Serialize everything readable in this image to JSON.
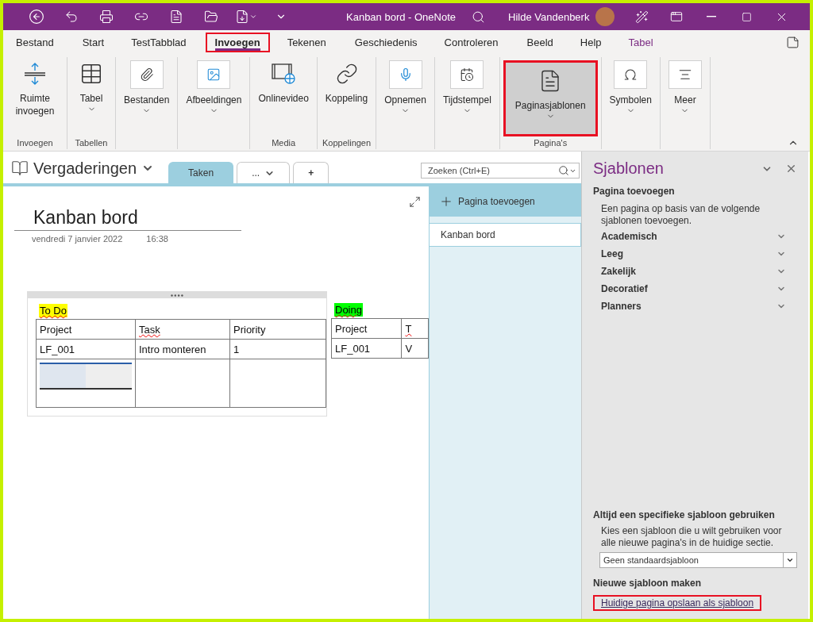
{
  "window": {
    "title": "Kanban bord - OneNote",
    "user": "Hilde Vandenberk"
  },
  "menu_tabs": [
    {
      "label": "Bestand",
      "selected": false,
      "highlighted": false,
      "kind": "normal"
    },
    {
      "label": "Start",
      "selected": false,
      "highlighted": false,
      "kind": "normal"
    },
    {
      "label": "TestTabblad",
      "selected": false,
      "highlighted": false,
      "kind": "normal"
    },
    {
      "label": "Invoegen",
      "selected": true,
      "highlighted": true,
      "kind": "normal"
    },
    {
      "label": "Tekenen",
      "selected": false,
      "highlighted": false,
      "kind": "normal"
    },
    {
      "label": "Geschiedenis",
      "selected": false,
      "highlighted": false,
      "kind": "normal"
    },
    {
      "label": "Controleren",
      "selected": false,
      "highlighted": false,
      "kind": "normal"
    },
    {
      "label": "Beeld",
      "selected": false,
      "highlighted": false,
      "kind": "normal"
    },
    {
      "label": "Help",
      "selected": false,
      "highlighted": false,
      "kind": "normal"
    },
    {
      "label": "Tabel",
      "selected": false,
      "highlighted": false,
      "kind": "contextual"
    }
  ],
  "ribbon_groups": [
    {
      "label": "Invoegen",
      "buttons": [
        {
          "label": "Ruimte invoegen",
          "kind": "plain",
          "dropdown": false,
          "highlighted": false
        }
      ]
    },
    {
      "label": "Tabellen",
      "buttons": [
        {
          "label": "Tabel",
          "kind": "plain",
          "dropdown": true,
          "highlighted": false
        }
      ]
    },
    {
      "buttons": [
        {
          "label": "Bestanden",
          "kind": "boxed",
          "dropdown": true,
          "highlighted": false
        }
      ]
    },
    {
      "buttons": [
        {
          "label": "Afbeeldingen",
          "kind": "boxed",
          "dropdown": true,
          "highlighted": false
        }
      ]
    },
    {
      "label": "Media",
      "buttons": [
        {
          "label": "Onlinevideo",
          "kind": "plain",
          "dropdown": false,
          "highlighted": false
        }
      ]
    },
    {
      "label": "Koppelingen",
      "buttons": [
        {
          "label": "Koppeling",
          "kind": "plain",
          "dropdown": false,
          "highlighted": false
        }
      ]
    },
    {
      "buttons": [
        {
          "label": "Opnemen",
          "kind": "boxed",
          "dropdown": true,
          "highlighted": false
        }
      ]
    },
    {
      "buttons": [
        {
          "label": "Tijdstempel",
          "kind": "boxed",
          "dropdown": true,
          "highlighted": false
        }
      ]
    },
    {
      "label": "Pagina's",
      "buttons": [
        {
          "label": "Paginasjablonen",
          "kind": "plain",
          "dropdown": true,
          "highlighted": true
        }
      ]
    },
    {
      "buttons": [
        {
          "label": "Symbolen",
          "kind": "boxed",
          "dropdown": true,
          "highlighted": false
        }
      ]
    },
    {
      "buttons": [
        {
          "label": "Meer",
          "kind": "boxed",
          "dropdown": true,
          "highlighted": false
        }
      ]
    }
  ],
  "notebook": {
    "name": "Vergaderingen",
    "section_tabs": [
      {
        "label": "Taken",
        "selected": true,
        "kind": "section"
      },
      {
        "label": "...",
        "selected": false,
        "kind": "more"
      },
      {
        "label": "+",
        "selected": false,
        "kind": "add"
      }
    ],
    "search": {
      "placeholder": "Zoeken (Ctrl+E)"
    }
  },
  "page": {
    "title": "Kanban bord",
    "date": "vendredi 7 janvier 2022",
    "time": "16:38",
    "lists": [
      {
        "heading": "To Do",
        "color": "#ffff00",
        "spell_error": true,
        "columns": [
          {
            "text": "Project",
            "spell_error": false
          },
          {
            "text": "Task",
            "spell_error": true
          },
          {
            "text": "Priority",
            "spell_error": false
          }
        ],
        "rows": [
          {
            "cells": [
              {
                "kind": "text",
                "text": "LF_001"
              },
              {
                "kind": "text",
                "text": "Intro monteren"
              },
              {
                "kind": "text",
                "text": "1"
              }
            ]
          },
          {
            "cells": [
              {
                "kind": "image"
              },
              {
                "kind": "empty"
              },
              {
                "kind": "empty"
              }
            ]
          }
        ]
      },
      {
        "heading": "Doing",
        "color": "#00ff00",
        "spell_error": true,
        "columns": [
          {
            "text": "Project",
            "spell_error": false
          },
          {
            "text": "T",
            "spell_error": true
          }
        ],
        "rows": [
          {
            "cells": [
              {
                "kind": "text",
                "text": "LF_001"
              },
              {
                "kind": "text",
                "text": "V"
              }
            ]
          }
        ]
      }
    ]
  },
  "page_list": {
    "add_label": "Pagina toevoegen",
    "pages": [
      {
        "title": "Kanban bord",
        "selected": true
      }
    ]
  },
  "templates": {
    "title": "Sjablonen",
    "add_heading": "Pagina toevoegen",
    "description": "Een pagina op basis van de volgende sjablonen toevoegen.",
    "categories": [
      {
        "label": "Academisch",
        "expanded": false
      },
      {
        "label": "Leeg",
        "expanded": false
      },
      {
        "label": "Zakelijk",
        "expanded": false
      },
      {
        "label": "Decoratief",
        "expanded": false
      },
      {
        "label": "Planners",
        "expanded": false
      }
    ],
    "default_heading": "Altijd een specifieke sjabloon gebruiken",
    "default_description": "Kies een sjabloon die u wilt gebruiken voor alle nieuwe pagina's in de huidige sectie.",
    "default_select": "Geen standaardsjabloon",
    "new_heading": "Nieuwe sjabloon maken",
    "save_link": {
      "label": "Huidige pagina opslaan als sjabloon",
      "highlighted": true
    }
  }
}
